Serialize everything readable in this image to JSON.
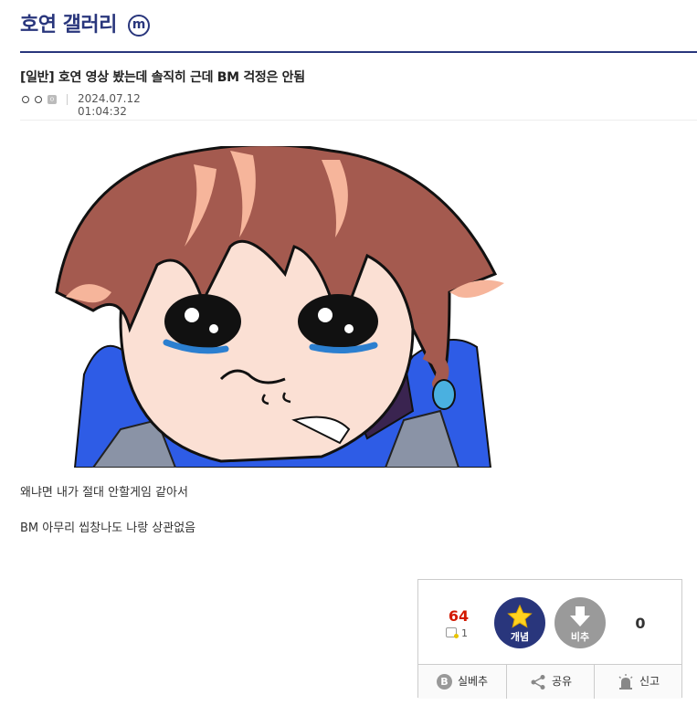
{
  "gallery": {
    "title": "호연 갤러리",
    "minor_badge": "m"
  },
  "post": {
    "title": "[일반] 호연 영상 봤는데 솔직히 근데 BM 걱정은 안됨",
    "author_nick": "ㅇㅇ",
    "date": "2024.07.12 01:04:32",
    "body": [
      "왜냐면 내가 절대 안할게임 같아서",
      "BM 아무리 씹창나도 나랑 상관없음"
    ]
  },
  "vote": {
    "up_count": "64",
    "fixed_count": "1",
    "up_label": "개념",
    "down_label": "비추",
    "down_count": "0",
    "up_color": "#29367c",
    "down_color": "#9a9a9a",
    "up_count_color": "#d31900"
  },
  "actions": [
    {
      "label": "실베추",
      "icon": "best-b-icon"
    },
    {
      "label": "공유",
      "icon": "share-icon"
    },
    {
      "label": "신고",
      "icon": "siren-icon"
    }
  ],
  "image": {
    "alt_subject": "crying-chibi-character-illustration"
  }
}
